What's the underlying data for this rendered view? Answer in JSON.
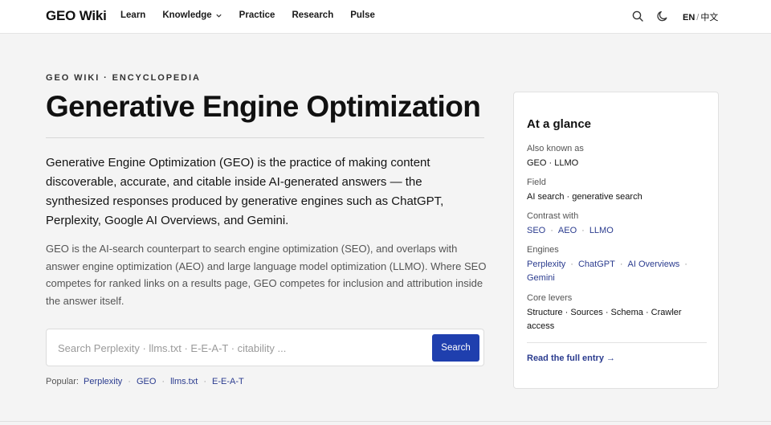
{
  "header": {
    "logo": "GEO Wiki",
    "nav": [
      {
        "label": "Learn"
      },
      {
        "label": "Knowledge",
        "has_dropdown": true
      },
      {
        "label": "Practice"
      },
      {
        "label": "Research"
      },
      {
        "label": "Pulse"
      }
    ],
    "icons": [
      "search-icon",
      "moon-icon"
    ],
    "lang_active": "EN",
    "lang_separator": "/",
    "lang_alt": "中文"
  },
  "main": {
    "eyebrow": "GEO WIKI · ENCYCLOPEDIA",
    "title": "Generative Engine Optimization",
    "lede": "Generative Engine Optimization (GEO) is the practice of making content discoverable, accurate, and citable inside AI-generated answers — the synthesized responses produced by generative engines such as ChatGPT, Perplexity, Google AI Overviews, and Gemini.",
    "body": "GEO is the AI-search counterpart to search engine optimization (SEO), and overlaps with answer engine optimization (AEO) and large language model optimization (LLMO). Where SEO competes for ranked links on a results page, GEO competes for inclusion and attribution inside the answer itself.",
    "search": {
      "placeholder": "Search Perplexity · llms.txt · E-E-A-T · citability ...",
      "button": "Search"
    },
    "popular_label": "Popular:",
    "popular": [
      "Perplexity",
      "GEO",
      "llms.txt",
      "E-E-A-T"
    ]
  },
  "glance": {
    "title": "At a glance",
    "aka_label": "Also known as",
    "aka_value": "GEO · LLMO",
    "field_label": "Field",
    "field_value": "AI search · generative search",
    "contrast_label": "Contrast with",
    "contrast_links": [
      "SEO",
      "AEO",
      "LLMO"
    ],
    "engines_label": "Engines",
    "engines_links": [
      "Perplexity",
      "ChatGPT",
      "AI Overviews",
      "Gemini"
    ],
    "levers_label": "Core levers",
    "levers_value": "Structure · Sources · Schema · Crawler access",
    "link": "Read the full entry →"
  },
  "colors": {
    "accent": "#1f3fae",
    "link": "#2b3c8f",
    "background": "#f4f4f4"
  }
}
